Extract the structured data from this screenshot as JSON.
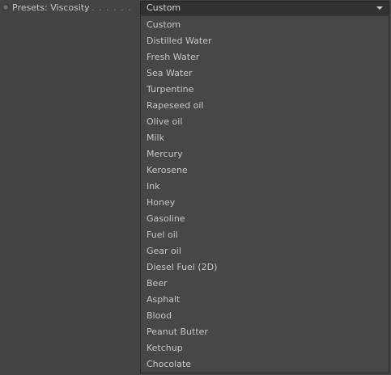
{
  "parameter": {
    "label": "Presets: Viscosity",
    "leader_dots": ". . . . . . . . . . . ."
  },
  "select": {
    "value": "Custom",
    "arrow_icon": "chevron-down-icon"
  },
  "dropdown": {
    "options": [
      "Custom",
      "Distilled Water",
      "Fresh Water",
      "Sea Water",
      "Turpentine",
      "Rapeseed oil",
      "Olive oil",
      "Milk",
      "Mercury",
      "Kerosene",
      "Ink",
      "Honey",
      "Gasoline",
      "Fuel oil",
      "Gear oil",
      "Diesel Fuel (2D)",
      "Beer",
      "Asphalt",
      "Blood",
      "Peanut Butter",
      "Ketchup",
      "Chocolate"
    ]
  }
}
